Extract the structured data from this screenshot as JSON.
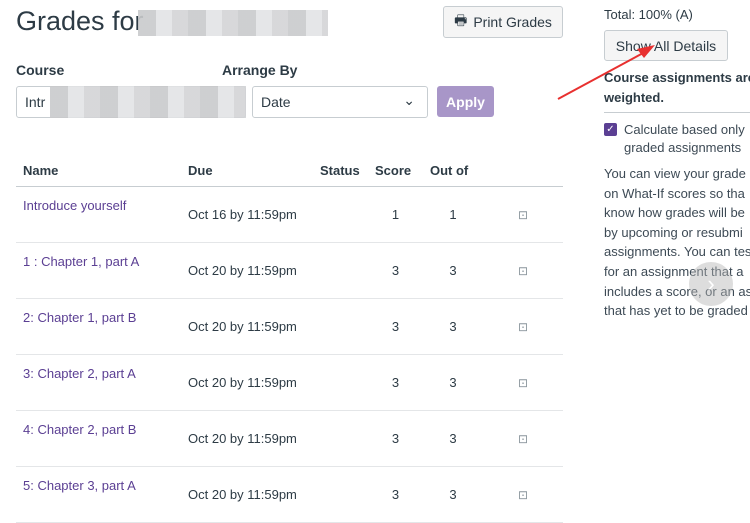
{
  "header": {
    "title": "Grades for",
    "print_label": "Print Grades"
  },
  "filters": {
    "course_label": "Course",
    "course_value": "Intr",
    "arrange_label": "Arrange By",
    "arrange_value": "Date",
    "apply_label": "Apply"
  },
  "table": {
    "columns": [
      "Name",
      "Due",
      "Status",
      "Score",
      "Out of"
    ],
    "rows": [
      {
        "name": "Introduce yourself",
        "due": "Oct 16 by 11:59pm",
        "status": "",
        "score": "1",
        "out_of": "1"
      },
      {
        "name": "1 : Chapter 1, part A",
        "due": "Oct 20 by 11:59pm",
        "status": "",
        "score": "3",
        "out_of": "3"
      },
      {
        "name": "2: Chapter 1, part B",
        "due": "Oct 20 by 11:59pm",
        "status": "",
        "score": "3",
        "out_of": "3"
      },
      {
        "name": "3: Chapter 2, part A",
        "due": "Oct 20 by 11:59pm",
        "status": "",
        "score": "3",
        "out_of": "3"
      },
      {
        "name": "4: Chapter 2, part B",
        "due": "Oct 20 by 11:59pm",
        "status": "",
        "score": "3",
        "out_of": "3"
      },
      {
        "name": "5: Chapter 3, part A",
        "due": "Oct 20 by 11:59pm",
        "status": "",
        "score": "3",
        "out_of": "3"
      }
    ]
  },
  "sidebar": {
    "total": "Total: 100% (A)",
    "show_details": "Show All Details",
    "weighted_note": "Course assignments are not weighted.",
    "weighted_line1": "Course assignments are",
    "weighted_line2": "weighted.",
    "checkbox_label_1": "Calculate based only",
    "checkbox_label_2": "graded assignments",
    "checkbox_checked": true,
    "paragraph": [
      "You can view your grade",
      "on What-If scores so tha",
      "know how grades will be",
      "by upcoming or resubmi",
      "assignments. You can tes",
      "for an assignment that a",
      "includes a score, or an as",
      "that has yet to be graded"
    ]
  },
  "colors": {
    "accent": "#5b3f93",
    "apply": "#a896c8",
    "arrow": "#e8302f"
  }
}
